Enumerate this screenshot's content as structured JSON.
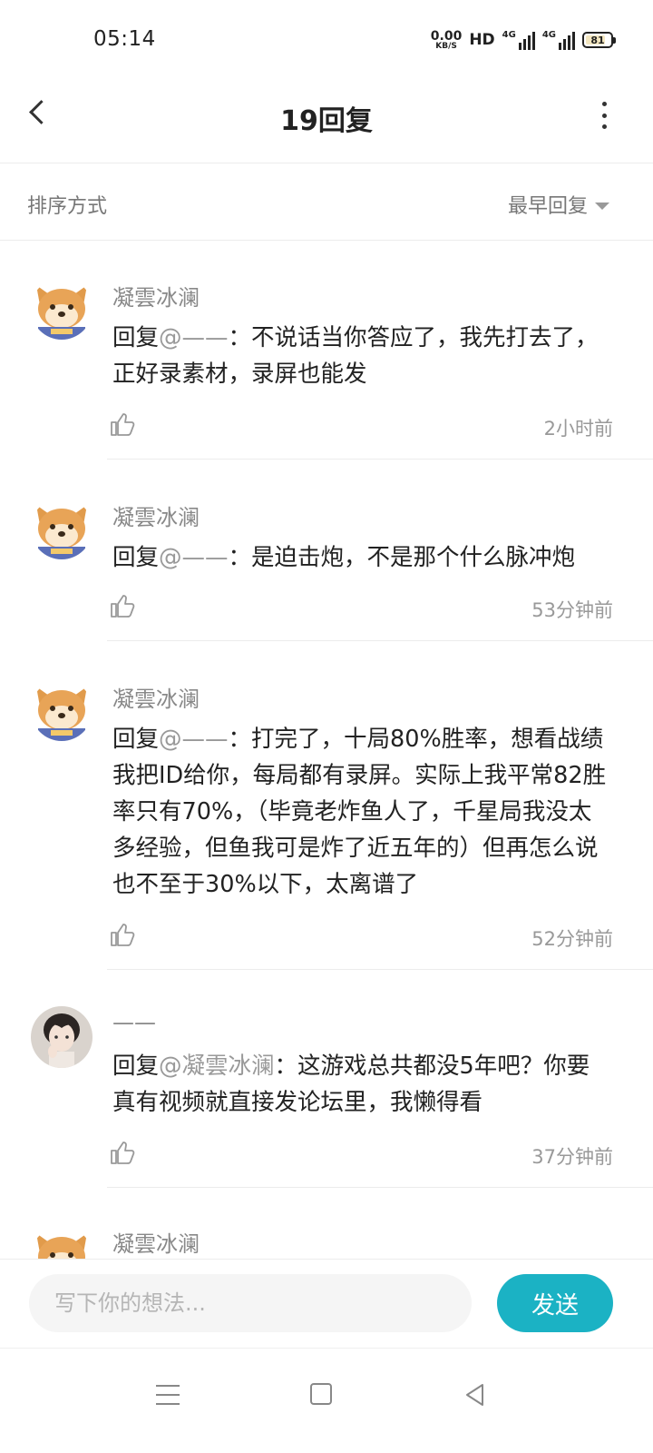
{
  "status_bar": {
    "time": "05:14",
    "net_speed_value": "0.00",
    "net_speed_unit": "KB/S",
    "hd_label": "HD",
    "signal1_label": "4G",
    "signal2_label": "4G",
    "battery_level": "81",
    "battery_color": "#f3e6bf"
  },
  "header": {
    "title": "19回复",
    "back_icon": "chevron-left-icon",
    "more_icon": "more-vertical-icon"
  },
  "sort": {
    "label": "排序方式",
    "selected": "最早回复"
  },
  "replies": [
    {
      "username": "凝雲冰澜",
      "prefix": "回复",
      "mention": "@——",
      "content": "：不说话当你答应了，我先打去了，正好录素材，录屏也能发",
      "time": "2小时前"
    },
    {
      "username": "凝雲冰澜",
      "prefix": "回复",
      "mention": "@——",
      "content": "：是迫击炮，不是那个什么脉冲炮",
      "time": "53分钟前"
    },
    {
      "username": "凝雲冰澜",
      "prefix": "回复",
      "mention": "@——",
      "content": "：打完了，十局80%胜率，想看战绩我把ID给你，每局都有录屏。实际上我平常82胜率只有70%，（毕竟老炸鱼人了，千星局我没太多经验，但鱼我可是炸了近五年的）但再怎么说也不至于30%以下，太离谱了",
      "time": "52分钟前"
    },
    {
      "username": "——",
      "prefix": "回复",
      "mention": "@凝雲冰澜",
      "content": "：这游戏总共都没5年吧？你要真有视频就直接发论坛里，我懒得看",
      "time": "37分钟前"
    },
    {
      "username": "凝雲冰澜"
    }
  ],
  "input": {
    "placeholder": "写下你的想法...",
    "send_label": "发送",
    "accent_color": "#1bb2c4"
  }
}
